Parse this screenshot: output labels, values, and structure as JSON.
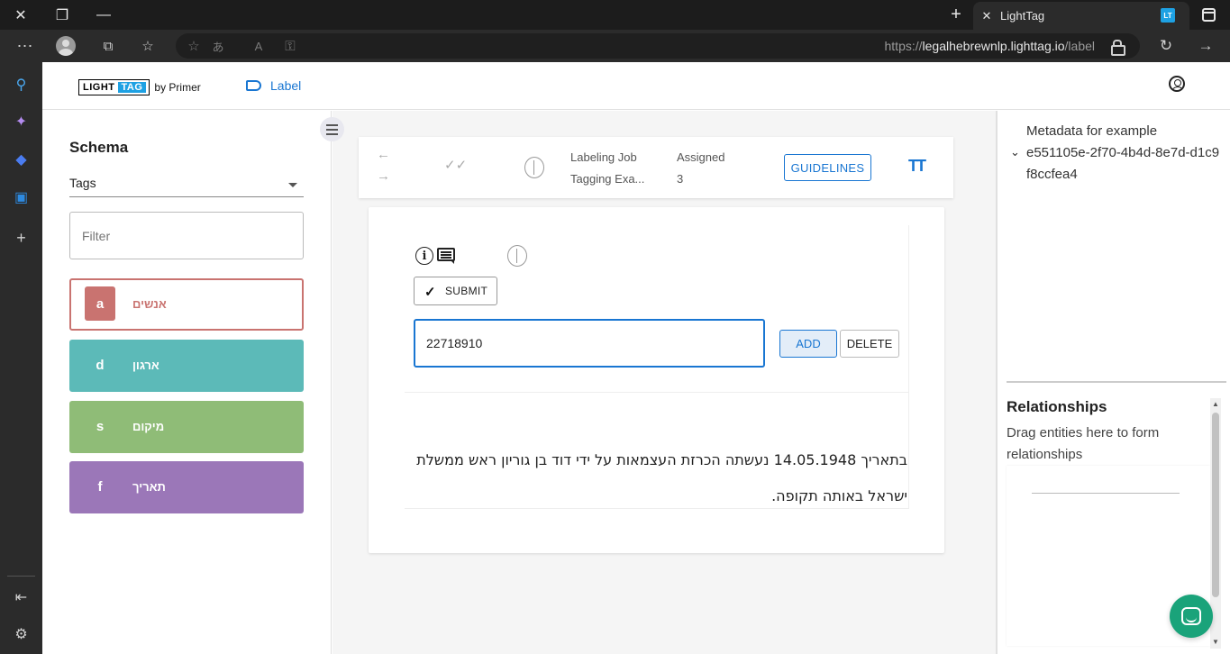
{
  "browser": {
    "tab_title": "LightTag",
    "tab_favicon": "LT",
    "url_prefix": "https://",
    "url_host": "legalhebrewnlp.lighttag.io",
    "url_path": "/label"
  },
  "header": {
    "logo_light": "LIGHT",
    "logo_tag": "TAG",
    "logo_by": "by Primer",
    "nav_label": "Label"
  },
  "schema": {
    "title": "Schema",
    "select_value": "Tags",
    "filter_placeholder": "Filter",
    "tags": [
      {
        "key": "a",
        "name": "אנשים",
        "color": "#c97370"
      },
      {
        "key": "d",
        "name": "ארגון",
        "color": "#5cbab8"
      },
      {
        "key": "s",
        "name": "מיקום",
        "color": "#8fbc77"
      },
      {
        "key": "f",
        "name": "תאריך",
        "color": "#9b77b8"
      }
    ]
  },
  "toolbar": {
    "job_label": "Labeling Job",
    "job_value": "Tagging Exa...",
    "assigned_label": "Assigned",
    "assigned_value": "3",
    "guidelines": "GUIDELINES",
    "text_size_icon": "TT"
  },
  "card": {
    "submit": "SUBMIT",
    "id_value": "22718910",
    "add": "ADD",
    "delete": "DELETE",
    "text": "בתאריך 14.05.1948 נעשתה הכרזת העצמאות על ידי דוד בן גוריון ראש ממשלת ישראל באותה תקופה."
  },
  "right_panel": {
    "metadata_title": "Metadata for example",
    "metadata_id": "e551105e-2f70-4b4d-8e7d-d1c9f8ccfea4",
    "relationships_title": "Relationships",
    "relationships_desc": "Drag entities here to form relationships"
  },
  "colors": {
    "accent": "#1976d2",
    "chat": "#1aa37a"
  }
}
